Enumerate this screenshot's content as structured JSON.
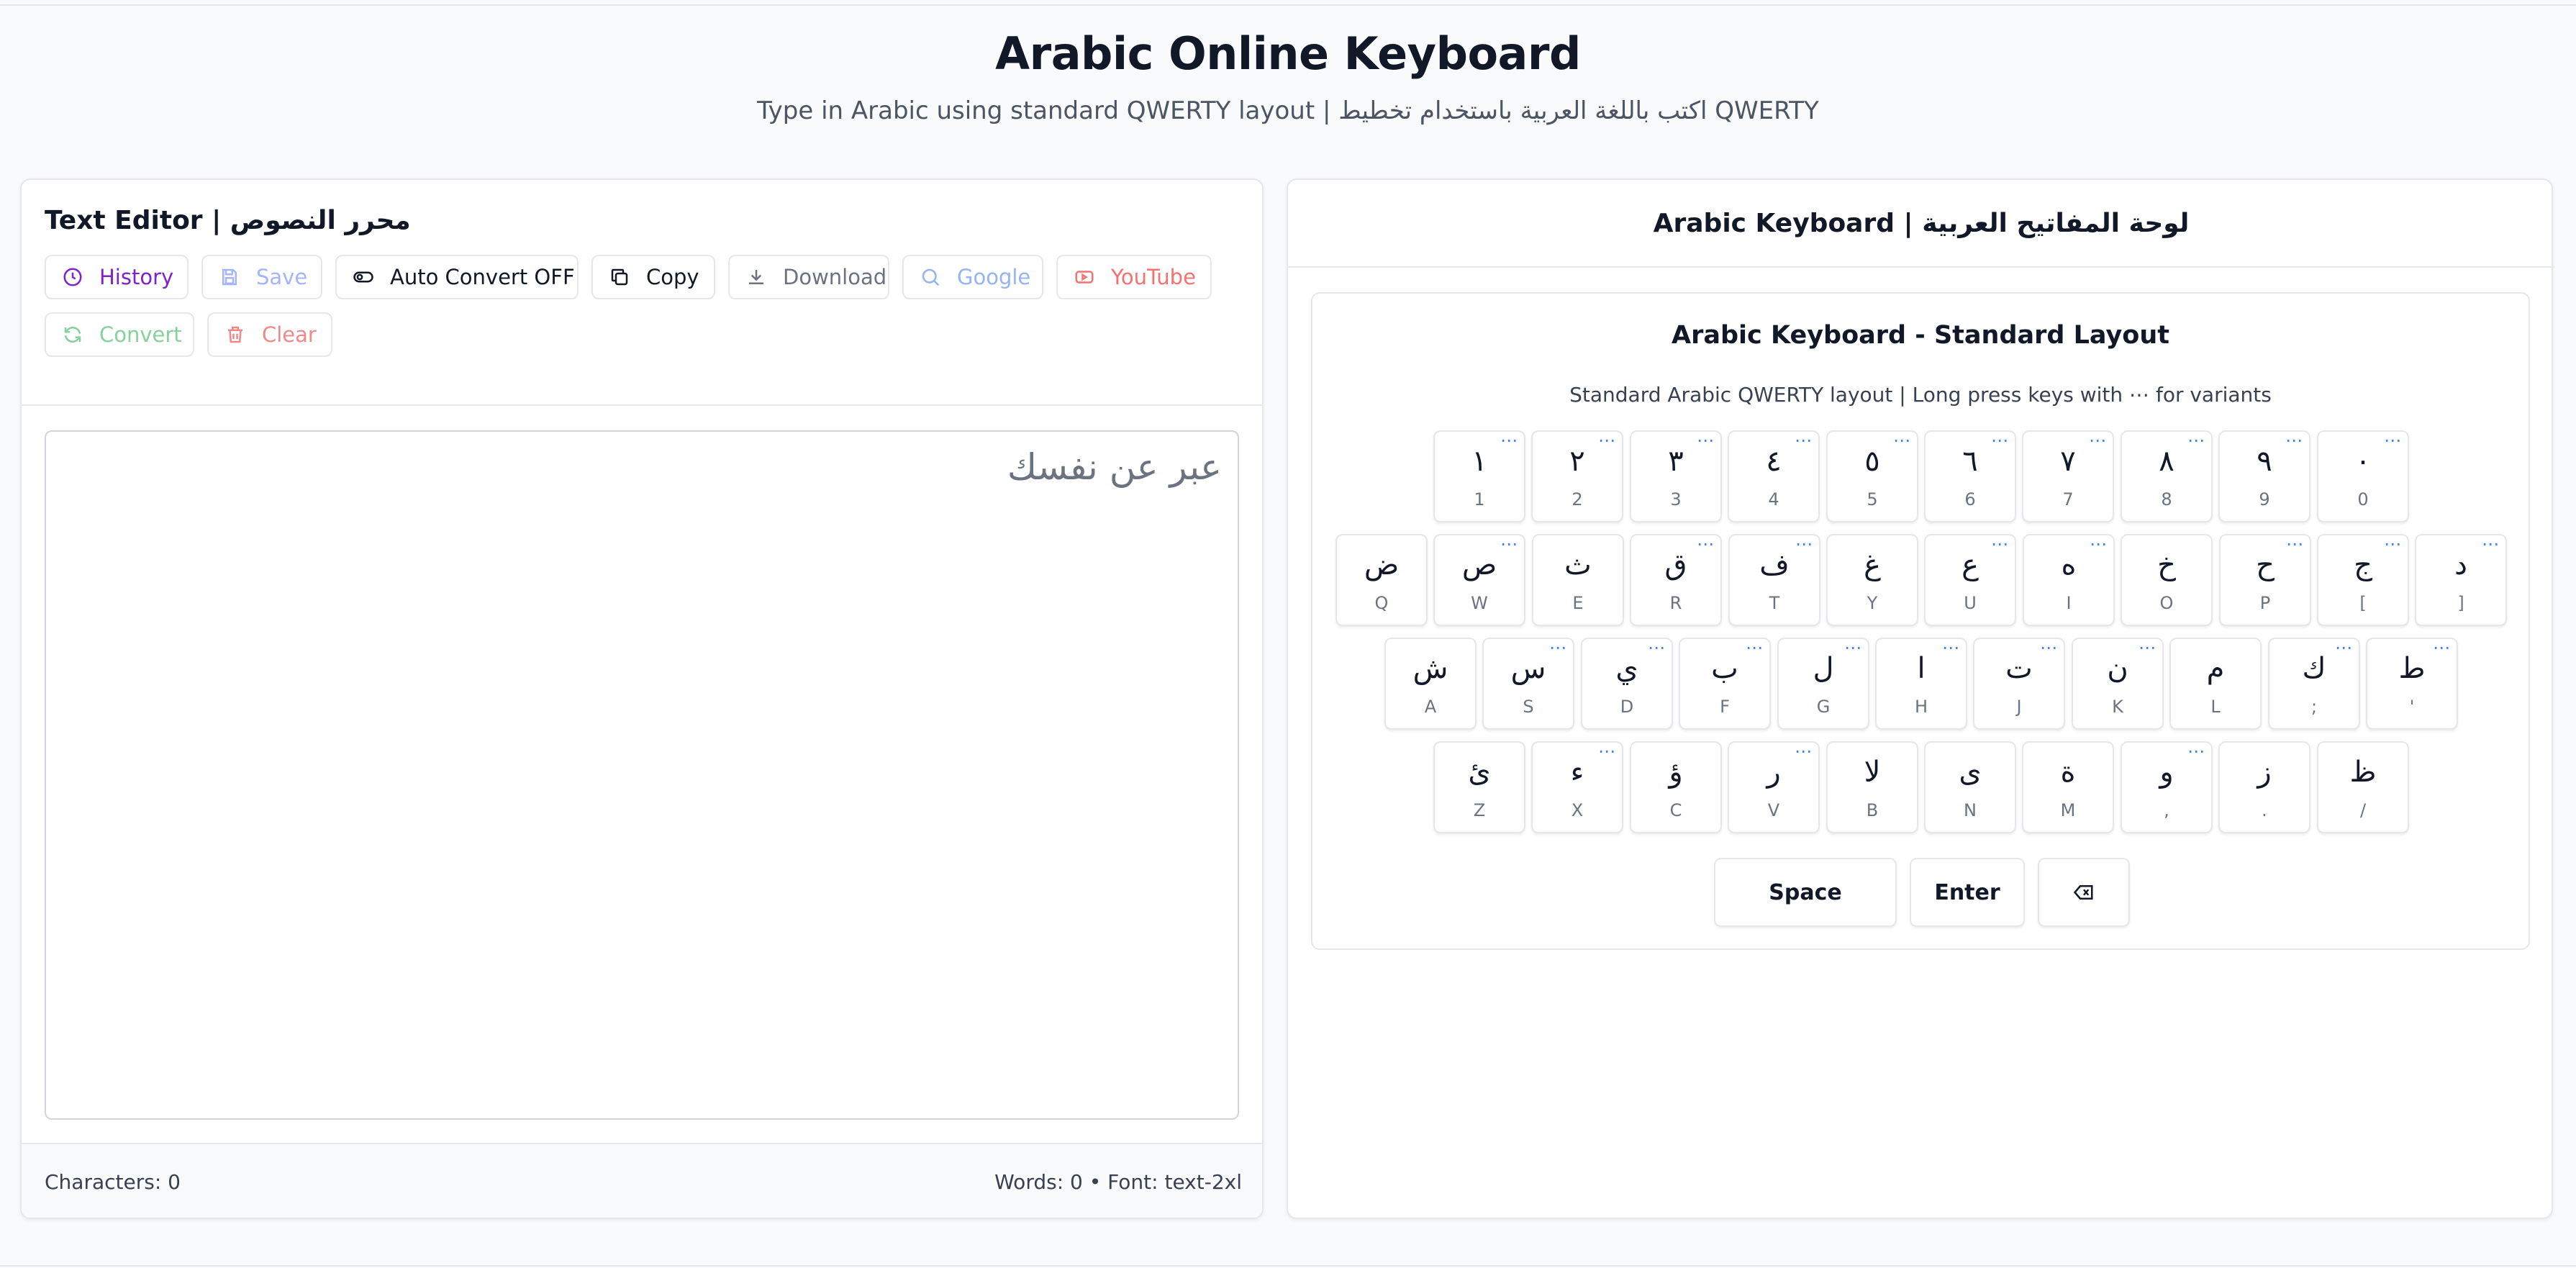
{
  "header": {
    "title": "Arabic Online Keyboard",
    "subtitle": "Type in Arabic using standard QWERTY layout | اكتب باللغة العربية باستخدام تخطيط QWERTY"
  },
  "editor": {
    "title": "Text Editor | محرر النصوص",
    "toolbar": [
      {
        "label": "History",
        "icon": "clock-icon",
        "color": "#7e22ce"
      },
      {
        "label": "Save",
        "icon": "save-icon",
        "color": "#a5b4fc"
      },
      {
        "label": "Auto Convert OFF",
        "icon": "toggle-icon",
        "color": "#111827"
      },
      {
        "label": "Copy",
        "icon": "copy-icon",
        "color": "#111827"
      },
      {
        "label": "Download",
        "icon": "download-icon",
        "color": "#6b7280"
      },
      {
        "label": "Google",
        "icon": "search-icon",
        "color": "#93b4f5"
      },
      {
        "label": "YouTube",
        "icon": "youtube-icon",
        "color": "#f87171"
      },
      {
        "label": "Convert",
        "icon": "refresh-icon",
        "color": "#86d19c"
      },
      {
        "label": "Clear",
        "icon": "trash-icon",
        "color": "#f08a8a"
      }
    ],
    "placeholder": "عبر عن نفسك",
    "status_left": "Characters: 0",
    "status_right": "Words: 0 • Font: text-2xl"
  },
  "keyboard": {
    "header": "Arabic Keyboard | لوحة المفاتيح العربية",
    "title": "Arabic Keyboard - Standard Layout",
    "subtitle": "Standard Arabic QWERTY layout | Long press keys with ⋯ for variants",
    "variant_marker": "⋯",
    "rows": [
      [
        {
          "ar": "١",
          "en": "1",
          "v": true
        },
        {
          "ar": "٢",
          "en": "2",
          "v": true
        },
        {
          "ar": "٣",
          "en": "3",
          "v": true
        },
        {
          "ar": "٤",
          "en": "4",
          "v": true
        },
        {
          "ar": "٥",
          "en": "5",
          "v": true
        },
        {
          "ar": "٦",
          "en": "6",
          "v": true
        },
        {
          "ar": "٧",
          "en": "7",
          "v": true
        },
        {
          "ar": "٨",
          "en": "8",
          "v": true
        },
        {
          "ar": "٩",
          "en": "9",
          "v": true
        },
        {
          "ar": "٠",
          "en": "0",
          "v": true
        }
      ],
      [
        {
          "ar": "ض",
          "en": "Q",
          "v": false
        },
        {
          "ar": "ص",
          "en": "W",
          "v": true
        },
        {
          "ar": "ث",
          "en": "E",
          "v": false
        },
        {
          "ar": "ق",
          "en": "R",
          "v": true
        },
        {
          "ar": "ف",
          "en": "T",
          "v": true
        },
        {
          "ar": "غ",
          "en": "Y",
          "v": false
        },
        {
          "ar": "ع",
          "en": "U",
          "v": true
        },
        {
          "ar": "ه",
          "en": "I",
          "v": true
        },
        {
          "ar": "خ",
          "en": "O",
          "v": false
        },
        {
          "ar": "ح",
          "en": "P",
          "v": true
        },
        {
          "ar": "ج",
          "en": "[",
          "v": true
        },
        {
          "ar": "د",
          "en": "]",
          "v": true
        }
      ],
      [
        {
          "ar": "ش",
          "en": "A",
          "v": false
        },
        {
          "ar": "س",
          "en": "S",
          "v": true
        },
        {
          "ar": "ي",
          "en": "D",
          "v": true
        },
        {
          "ar": "ب",
          "en": "F",
          "v": true
        },
        {
          "ar": "ل",
          "en": "G",
          "v": true
        },
        {
          "ar": "ا",
          "en": "H",
          "v": true
        },
        {
          "ar": "ت",
          "en": "J",
          "v": true
        },
        {
          "ar": "ن",
          "en": "K",
          "v": true
        },
        {
          "ar": "م",
          "en": "L",
          "v": false
        },
        {
          "ar": "ك",
          "en": ";",
          "v": true
        },
        {
          "ar": "ط",
          "en": "'",
          "v": true
        }
      ],
      [
        {
          "ar": "ئ",
          "en": "Z",
          "v": false
        },
        {
          "ar": "ء",
          "en": "X",
          "v": true
        },
        {
          "ar": "ؤ",
          "en": "C",
          "v": false
        },
        {
          "ar": "ر",
          "en": "V",
          "v": true
        },
        {
          "ar": "لا",
          "en": "B",
          "v": false
        },
        {
          "ar": "ى",
          "en": "N",
          "v": false
        },
        {
          "ar": "ة",
          "en": "M",
          "v": false
        },
        {
          "ar": "و",
          "en": ",",
          "v": true
        },
        {
          "ar": "ز",
          "en": ".",
          "v": false
        },
        {
          "ar": "ظ",
          "en": "/",
          "v": false
        }
      ]
    ],
    "space_label": "Space",
    "enter_label": "Enter",
    "backspace_icon": "backspace-icon"
  }
}
